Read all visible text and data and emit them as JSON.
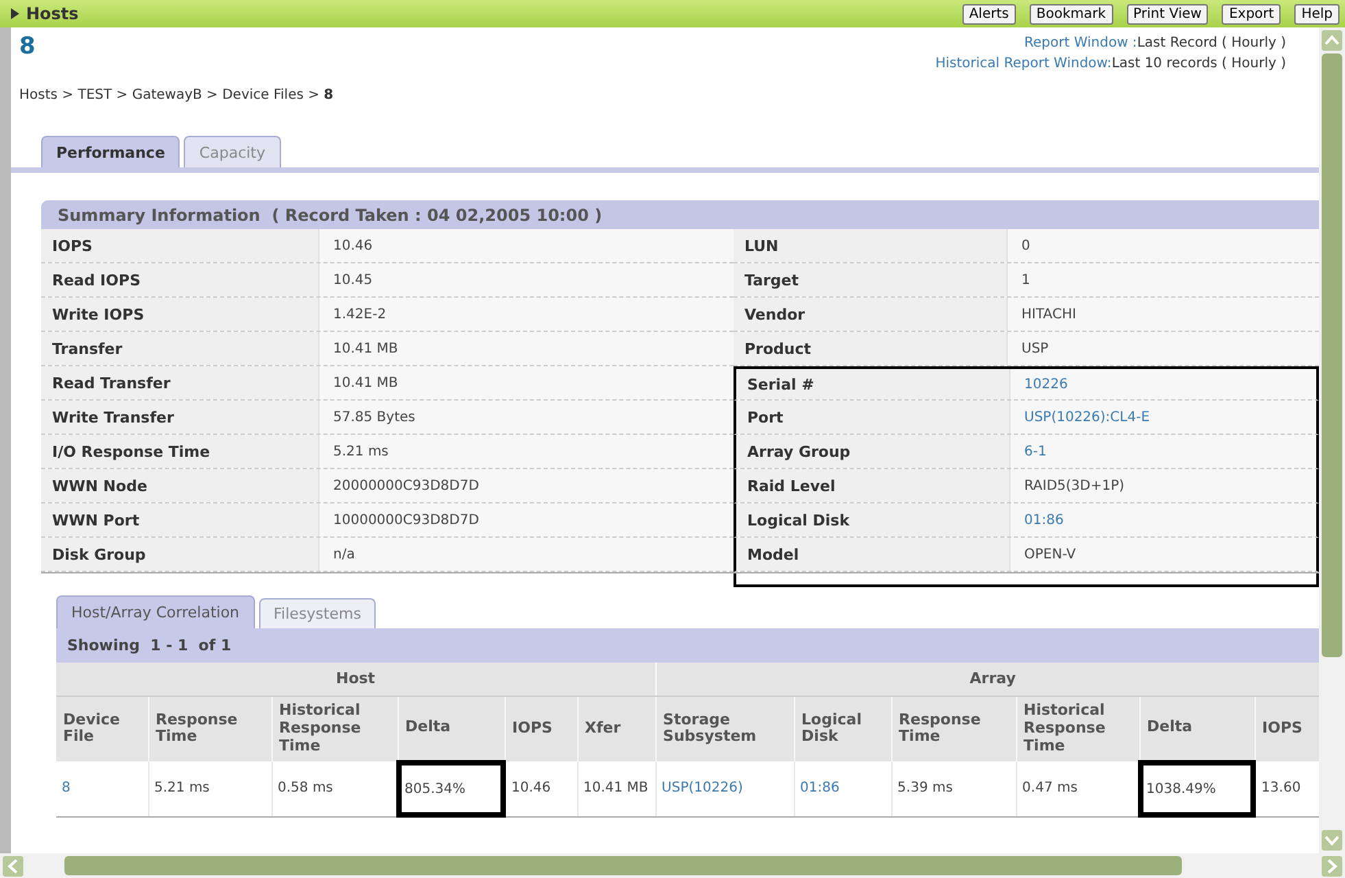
{
  "header": {
    "title": "Hosts",
    "buttons": [
      "Alerts",
      "Bookmark",
      "Print View",
      "Export",
      "Help"
    ]
  },
  "heading": "8",
  "report_windows": [
    {
      "label": "Report Window :",
      "value": "Last Record ( Hourly )"
    },
    {
      "label": "Historical Report Window:",
      "value": "Last 10 records ( Hourly )"
    }
  ],
  "breadcrumb": "Hosts > TEST > GatewayB > Device Files > **8**",
  "tabs": [
    {
      "label": "Performance",
      "selected": true
    },
    {
      "label": "Capacity",
      "selected": false
    }
  ],
  "summary": {
    "title": "Summary Information  ( Record Taken : 04 02,2005 10:00 )",
    "left": [
      {
        "label": "IOPS",
        "value": "10.46"
      },
      {
        "label": "Read IOPS",
        "value": "10.45"
      },
      {
        "label": "Write IOPS",
        "value": "1.42E-2"
      },
      {
        "label": "Transfer",
        "value": "10.41 MB"
      },
      {
        "label": "Read Transfer",
        "value": "10.41 MB"
      },
      {
        "label": "Write Transfer",
        "value": "57.85 Bytes"
      },
      {
        "label": "I/O Response Time",
        "value": "5.21 ms"
      },
      {
        "label": "WWN Node",
        "value": "20000000C93D8D7D"
      },
      {
        "label": "WWN Port",
        "value": "10000000C93D8D7D"
      },
      {
        "label": "Disk Group",
        "value": "n/a"
      }
    ],
    "right": [
      {
        "label": "LUN",
        "value": "0",
        "link": false,
        "highlighted": false
      },
      {
        "label": "Target",
        "value": "1",
        "link": false,
        "highlighted": false
      },
      {
        "label": "Vendor",
        "value": "HITACHI",
        "link": false,
        "highlighted": false
      },
      {
        "label": "Product",
        "value": "USP",
        "link": false,
        "highlighted": false
      },
      {
        "label": "Serial #",
        "value": "10226",
        "link": true,
        "highlighted": true
      },
      {
        "label": "Port",
        "value": "USP(10226):CL4-E",
        "link": true,
        "highlighted": true
      },
      {
        "label": "Array Group",
        "value": "6-1",
        "link": true,
        "highlighted": true
      },
      {
        "label": "Raid Level",
        "value": "RAID5(3D+1P)",
        "link": false,
        "highlighted": true
      },
      {
        "label": "Logical Disk",
        "value": "01:86",
        "link": true,
        "highlighted": true
      },
      {
        "label": "Model",
        "value": "OPEN-V",
        "link": false,
        "highlighted": true
      }
    ]
  },
  "lower_tabs": [
    {
      "label": "Host/Array Correlation",
      "selected": true
    },
    {
      "label": "Filesystems",
      "selected": false
    }
  ],
  "showing": "Showing  1 - 1  of 1",
  "correlation": {
    "groups": [
      {
        "label": "Host",
        "columns": [
          "Device File",
          "Response Time",
          "Historical Response Time",
          "Delta",
          "IOPS",
          "Xfer"
        ]
      },
      {
        "label": "Array",
        "columns": [
          "Storage Subsystem",
          "Logical Disk",
          "Response Time",
          "Historical Response Time",
          "Delta",
          "IOPS"
        ]
      }
    ],
    "rows": [
      [
        {
          "text": "8",
          "link": true,
          "highlighted": false
        },
        {
          "text": "5.21 ms",
          "link": false,
          "highlighted": false
        },
        {
          "text": "0.58 ms",
          "link": false,
          "highlighted": false
        },
        {
          "text": "805.34%",
          "link": false,
          "highlighted": true
        },
        {
          "text": "10.46",
          "link": false,
          "highlighted": false
        },
        {
          "text": "10.41 MB",
          "link": false,
          "highlighted": false
        },
        {
          "text": "USP(10226)",
          "link": true,
          "highlighted": false
        },
        {
          "text": "01:86",
          "link": true,
          "highlighted": false
        },
        {
          "text": "5.39 ms",
          "link": false,
          "highlighted": false
        },
        {
          "text": "0.47 ms",
          "link": false,
          "highlighted": false
        },
        {
          "text": "1038.49%",
          "link": false,
          "highlighted": true
        },
        {
          "text": "13.60",
          "link": false,
          "highlighted": false
        }
      ]
    ]
  }
}
